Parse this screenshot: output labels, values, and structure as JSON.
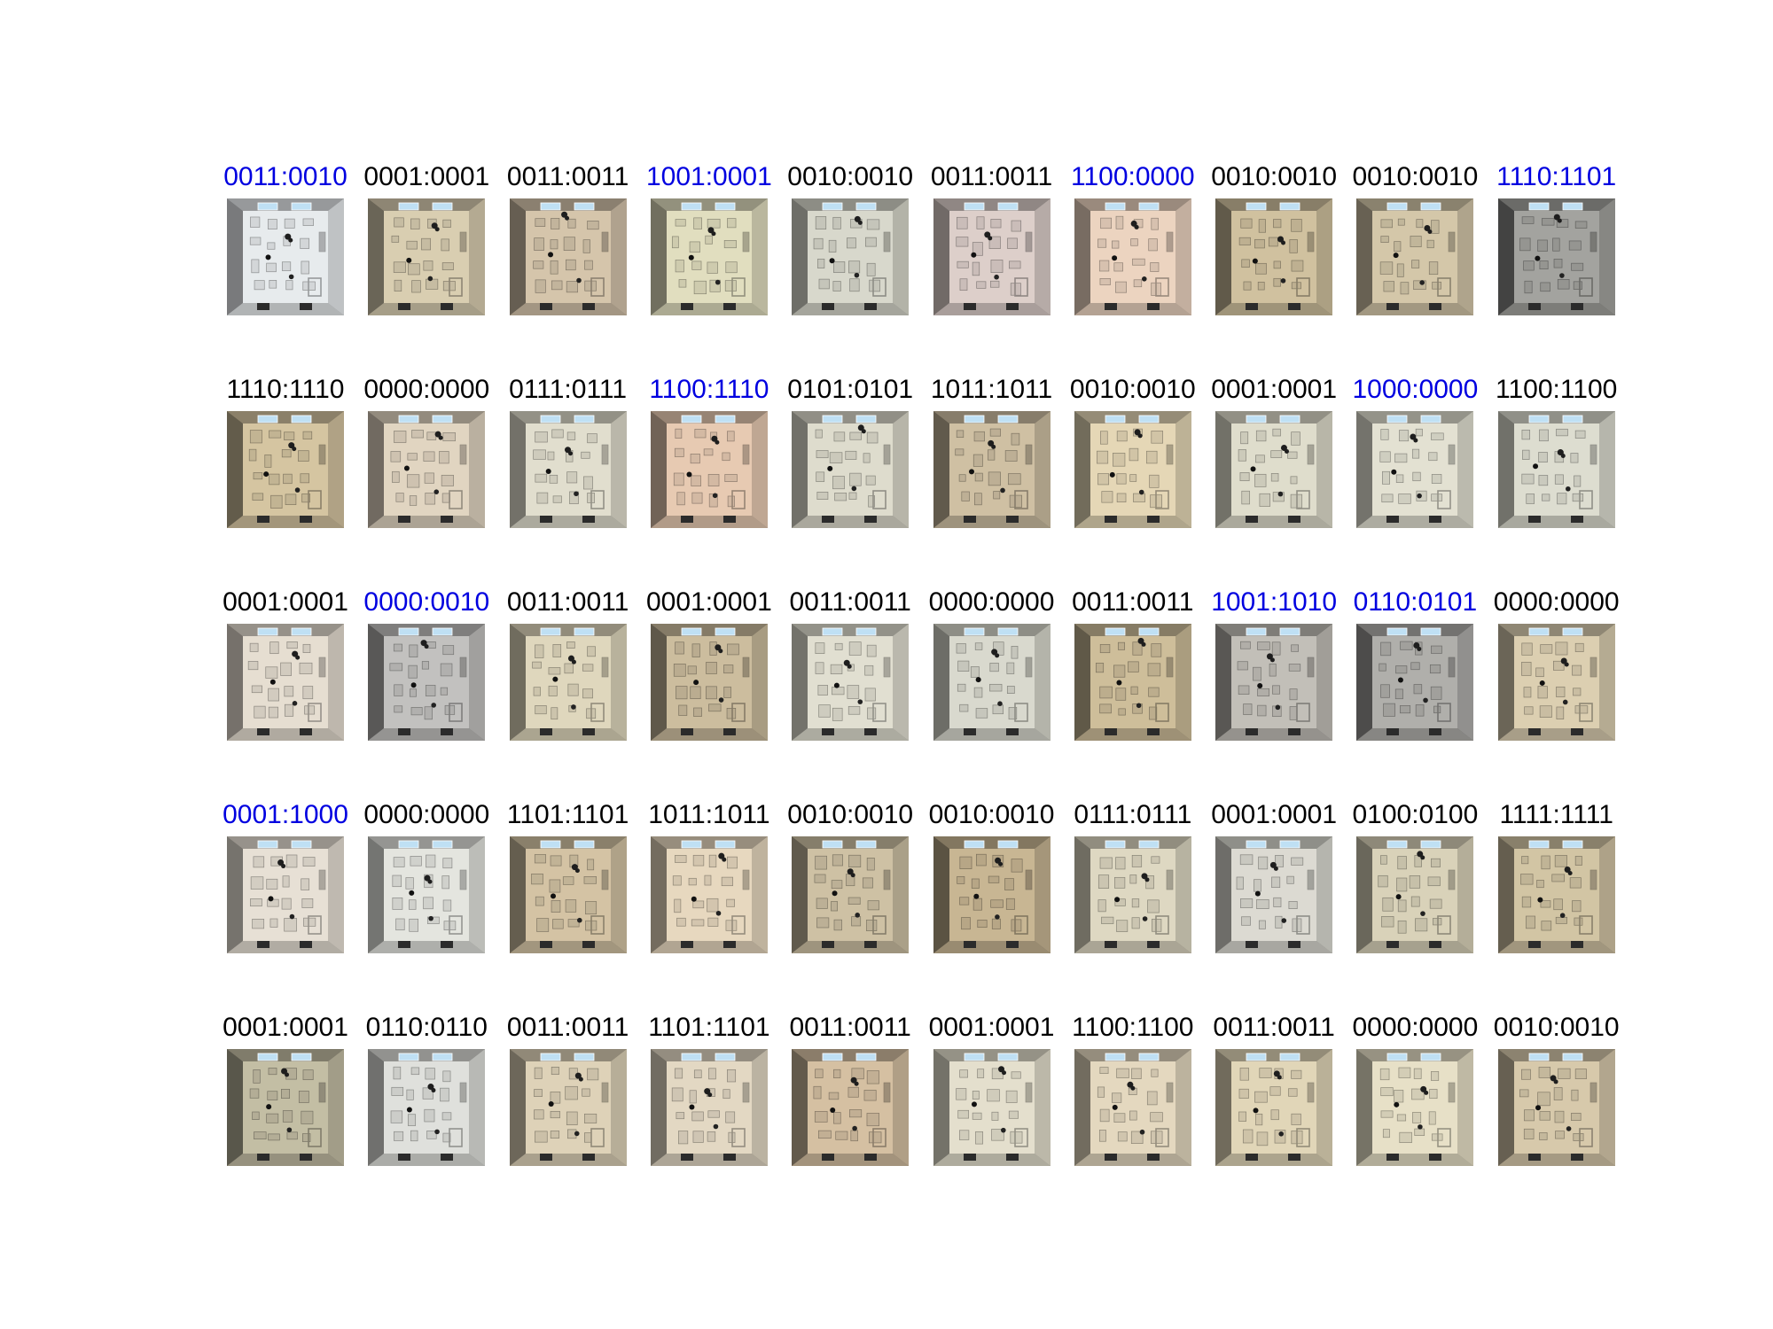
{
  "colors": {
    "mismatch": "#0000e0",
    "match": "#000000"
  },
  "image_kind": "overhead-room-photo",
  "rows": [
    {
      "cells": [
        {
          "label": "0011:0010",
          "tone": "#c9ccce",
          "dark": 0.2
        },
        {
          "label": "0001:0001",
          "tone": "#bdb39a",
          "dark": 0.35
        },
        {
          "label": "0011:0011",
          "tone": "#b9ab95",
          "dark": 0.4
        },
        {
          "label": "1001:0001",
          "tone": "#c4c1a6",
          "dark": 0.3
        },
        {
          "label": "0010:0010",
          "tone": "#bcbcb1",
          "dark": 0.25
        },
        {
          "label": "0011:0011",
          "tone": "#c0b4b0",
          "dark": 0.25
        },
        {
          "label": "1100:0000",
          "tone": "#cdb8a7",
          "dark": 0.25
        },
        {
          "label": "0010:0010",
          "tone": "#b5a88a",
          "dark": 0.45
        },
        {
          "label": "0010:0010",
          "tone": "#b8ad93",
          "dark": 0.35
        },
        {
          "label": "1110:1101",
          "tone": "#8e8e8a",
          "dark": 0.7
        }
      ]
    },
    {
      "cells": [
        {
          "label": "1110:1110",
          "tone": "#b9ab8c",
          "dark": 0.45
        },
        {
          "label": "0000:0000",
          "tone": "#c4b9a8",
          "dark": 0.3
        },
        {
          "label": "0111:0111",
          "tone": "#c4c1b3",
          "dark": 0.25
        },
        {
          "label": "1100:1110",
          "tone": "#c9b09b",
          "dark": 0.35
        },
        {
          "label": "0101:0101",
          "tone": "#c1bfb2",
          "dark": 0.25
        },
        {
          "label": "1011:1011",
          "tone": "#b4a78e",
          "dark": 0.45
        },
        {
          "label": "0010:0010",
          "tone": "#c7bb9e",
          "dark": 0.3
        },
        {
          "label": "0001:0001",
          "tone": "#c2c0b1",
          "dark": 0.25
        },
        {
          "label": "1000:0000",
          "tone": "#c5c4b7",
          "dark": 0.25
        },
        {
          "label": "1100:1100",
          "tone": "#c0c0b5",
          "dark": 0.25
        }
      ]
    },
    {
      "cells": [
        {
          "label": "0001:0001",
          "tone": "#c8c1b6",
          "dark": 0.25
        },
        {
          "label": "0000:0010",
          "tone": "#a9a8a6",
          "dark": 0.5
        },
        {
          "label": "0011:0011",
          "tone": "#c2bba4",
          "dark": 0.3
        },
        {
          "label": "0001:0001",
          "tone": "#b1a489",
          "dark": 0.45
        },
        {
          "label": "0011:0011",
          "tone": "#c4c2b6",
          "dark": 0.25
        },
        {
          "label": "0000:0000",
          "tone": "#bdbdb3",
          "dark": 0.3
        },
        {
          "label": "0011:0011",
          "tone": "#b3a586",
          "dark": 0.45
        },
        {
          "label": "1001:1010",
          "tone": "#a9a6a0",
          "dark": 0.5
        },
        {
          "label": "0110:0101",
          "tone": "#999895",
          "dark": 0.6
        },
        {
          "label": "0000:0000",
          "tone": "#bfb49a",
          "dark": 0.35
        }
      ]
    },
    {
      "cells": [
        {
          "label": "0001:1000",
          "tone": "#c9c3b9",
          "dark": 0.25
        },
        {
          "label": "0000:0000",
          "tone": "#c6c7c2",
          "dark": 0.25
        },
        {
          "label": "1101:1101",
          "tone": "#b8aa8f",
          "dark": 0.4
        },
        {
          "label": "1011:1011",
          "tone": "#c9bca6",
          "dark": 0.3
        },
        {
          "label": "0010:0010",
          "tone": "#b3a88f",
          "dark": 0.45
        },
        {
          "label": "0010:0010",
          "tone": "#ae9e80",
          "dark": 0.5
        },
        {
          "label": "0111:0111",
          "tone": "#c1bca9",
          "dark": 0.3
        },
        {
          "label": "0001:0001",
          "tone": "#bfbeb7",
          "dark": 0.3
        },
        {
          "label": "0100:0100",
          "tone": "#bdb7a1",
          "dark": 0.35
        },
        {
          "label": "1111:1111",
          "tone": "#b7ab8f",
          "dark": 0.4
        }
      ]
    },
    {
      "cells": [
        {
          "label": "0001:0001",
          "tone": "#aaa58f",
          "dark": 0.5
        },
        {
          "label": "0110:0110",
          "tone": "#c2c3bf",
          "dark": 0.3
        },
        {
          "label": "0011:0011",
          "tone": "#c1b7a0",
          "dark": 0.35
        },
        {
          "label": "1101:1101",
          "tone": "#c5bcaa",
          "dark": 0.3
        },
        {
          "label": "0011:0011",
          "tone": "#b9a78d",
          "dark": 0.45
        },
        {
          "label": "0001:0001",
          "tone": "#c6c2b2",
          "dark": 0.25
        },
        {
          "label": "1100:1100",
          "tone": "#c6bca6",
          "dark": 0.3
        },
        {
          "label": "0011:0011",
          "tone": "#c4baa0",
          "dark": 0.3
        },
        {
          "label": "0000:0000",
          "tone": "#c9c3ad",
          "dark": 0.25
        },
        {
          "label": "0010:0010",
          "tone": "#bbaf95",
          "dark": 0.4
        }
      ]
    }
  ]
}
